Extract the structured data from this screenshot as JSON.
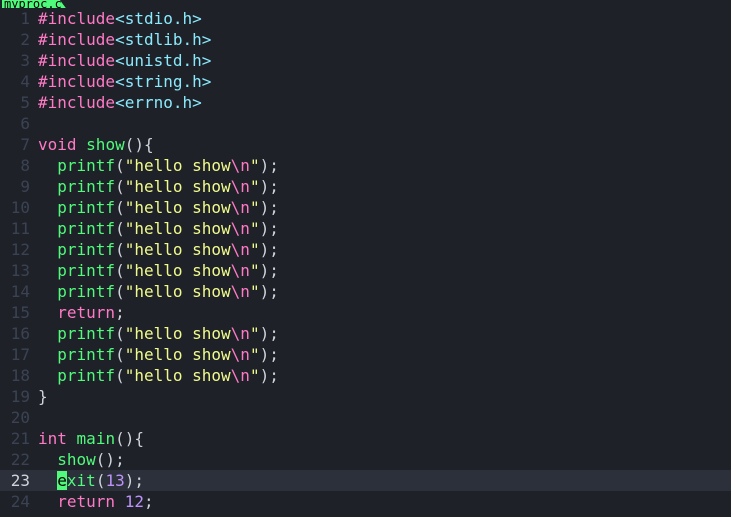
{
  "tab": {
    "label": "myproc.c"
  },
  "includes": [
    "stdio.h",
    "stdlib.h",
    "unistd.h",
    "string.h",
    "errno.h"
  ],
  "func_show": {
    "ret": "void",
    "name": "show",
    "printf_arg": "hello show",
    "esc": "\\n"
  },
  "func_main": {
    "ret": "int",
    "name": "main",
    "call": "show",
    "exit_fn": "exit",
    "exit_arg": "13",
    "return_val": "12"
  },
  "kw": {
    "include": "#include",
    "return": "return",
    "printf": "printf"
  },
  "lineno": {
    "l1": "1",
    "l2": "2",
    "l3": "3",
    "l4": "4",
    "l5": "5",
    "l6": "6",
    "l7": "7",
    "l8": "8",
    "l9": "9",
    "l10": "10",
    "l11": "11",
    "l12": "12",
    "l13": "13",
    "l14": "14",
    "l15": "15",
    "l16": "16",
    "l17": "17",
    "l18": "18",
    "l19": "19",
    "l20": "20",
    "l21": "21",
    "l22": "22",
    "l23": "23",
    "l24": "24"
  },
  "current_line": 23,
  "cursor_char": "e",
  "exit_rest": "xit"
}
